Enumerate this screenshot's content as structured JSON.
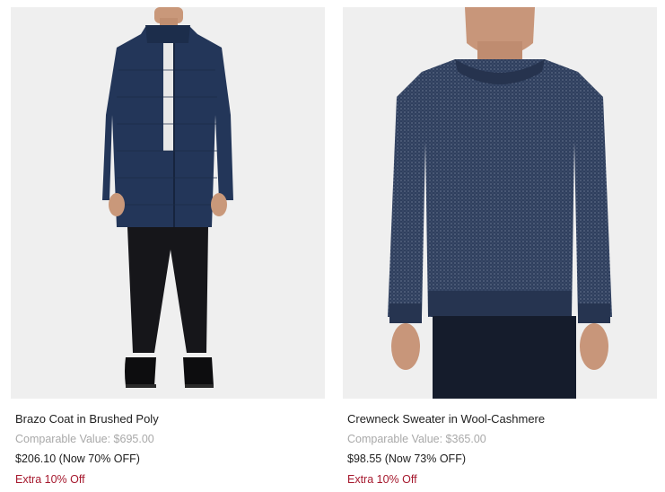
{
  "products": [
    {
      "name": "Brazo Coat in Brushed Poly",
      "comparable": "Comparable Value: $695.00",
      "price": "$206.10 (Now 70% OFF)",
      "promo": "Extra 10% Off",
      "image": "navy-quilted-coat-on-model"
    },
    {
      "name": "Crewneck Sweater in Wool-Cashmere",
      "comparable": "Comparable Value: $365.00",
      "price": "$98.55 (Now 73% OFF)",
      "promo": "Extra 10% Off",
      "image": "navy-knit-sweater-on-model"
    }
  ],
  "colors": {
    "image_bg": "#efefef",
    "navy": "#23375c",
    "promo_red": "#a6192e",
    "muted_gray": "#a9a9a9"
  }
}
